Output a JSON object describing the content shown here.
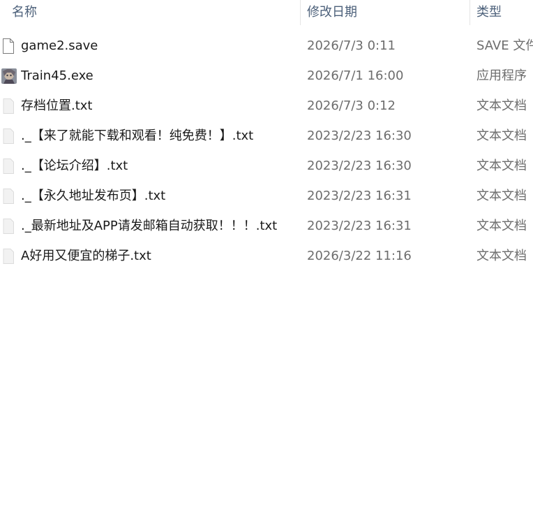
{
  "columns": {
    "name": "名称",
    "date": "修改日期",
    "type": "类型"
  },
  "files": [
    {
      "name": "game2.save",
      "date": "2026/7/3 0:11",
      "type": "SAVE 文件",
      "icon": "blank-file-icon"
    },
    {
      "name": "Train45.exe",
      "date": "2026/7/1 16:00",
      "type": "应用程序",
      "icon": "app-exe-icon"
    },
    {
      "name": "存档位置.txt",
      "date": "2026/7/3 0:12",
      "type": "文本文档",
      "icon": "text-file-icon"
    },
    {
      "name": "._【来了就能下载和观看！纯免费！】.txt",
      "date": "2023/2/23 16:30",
      "type": "文本文档",
      "icon": "text-file-icon"
    },
    {
      "name": "._【论坛介绍】.txt",
      "date": "2023/2/23 16:30",
      "type": "文本文档",
      "icon": "text-file-icon"
    },
    {
      "name": "._【永久地址发布页】.txt",
      "date": "2023/2/23 16:31",
      "type": "文本文档",
      "icon": "text-file-icon"
    },
    {
      "name": "._最新地址及APP请发邮箱自动获取！！！.txt",
      "date": "2023/2/23 16:31",
      "type": "文本文档",
      "icon": "text-file-icon"
    },
    {
      "name": "A好用又便宜的梯子.txt",
      "date": "2026/3/22 11:16",
      "type": "文本文档",
      "icon": "text-file-icon"
    }
  ],
  "colors": {
    "header_text": "#4c607a",
    "name_text": "#1a1a1a",
    "meta_text": "#6d6d6d",
    "hover_bg": "#e5f3ff"
  }
}
